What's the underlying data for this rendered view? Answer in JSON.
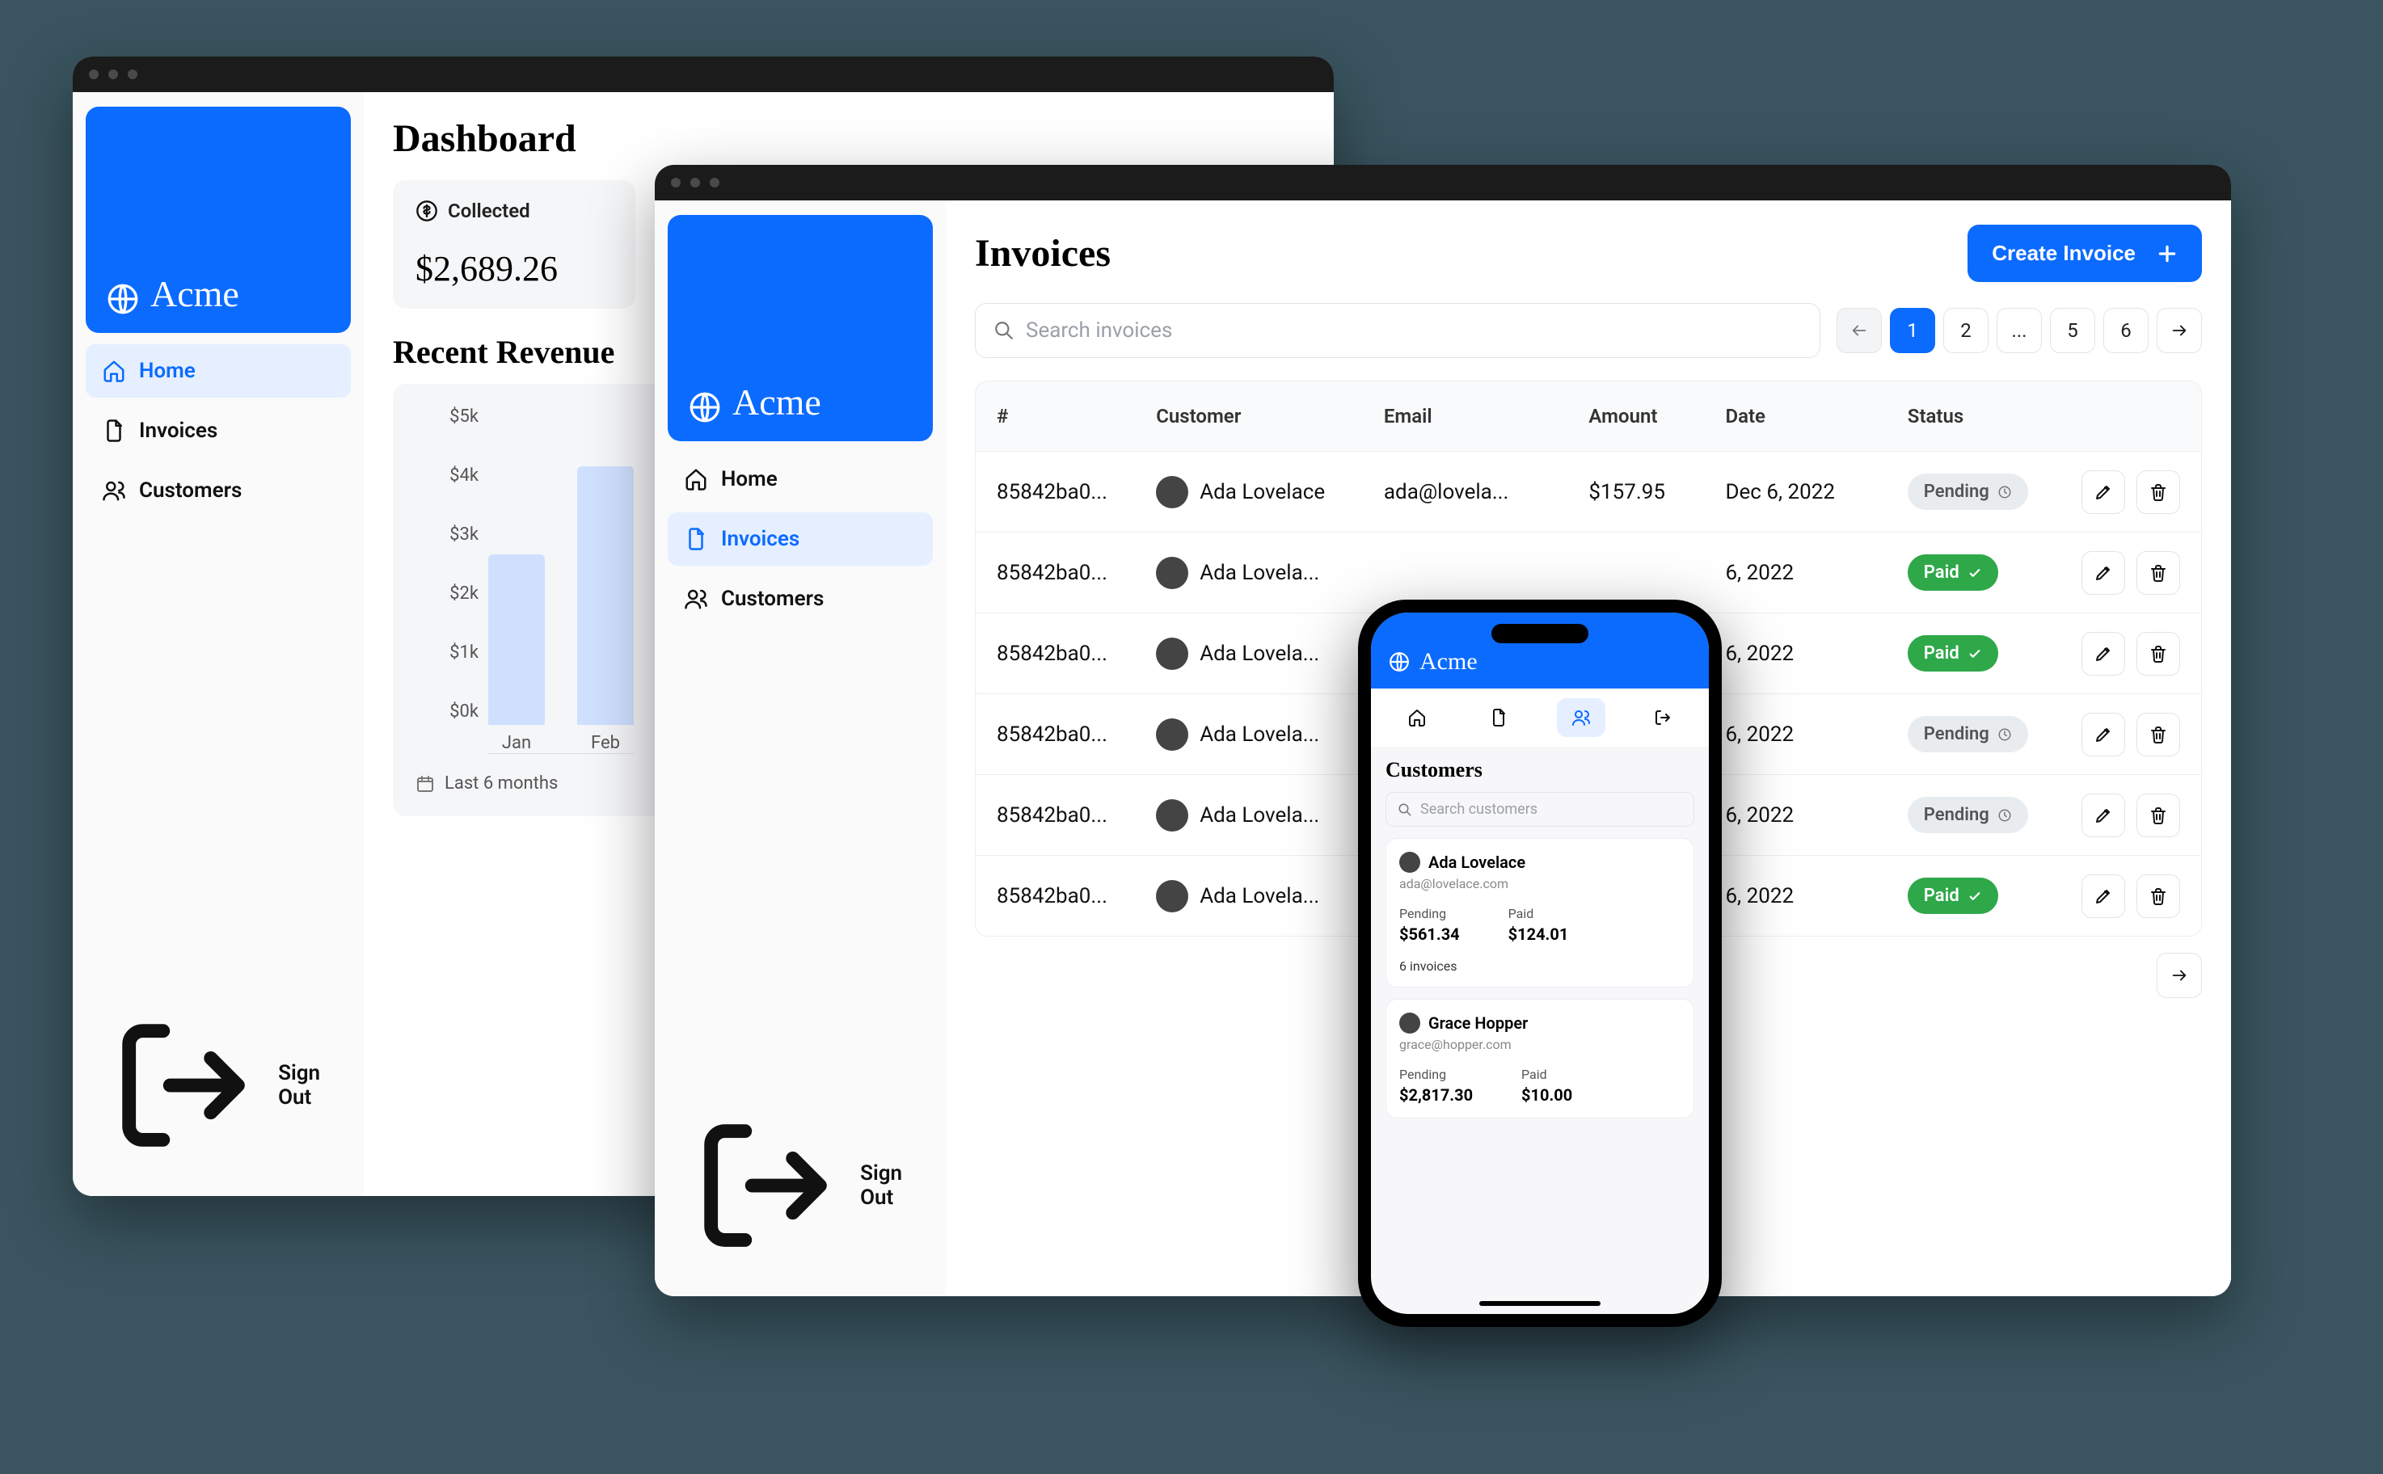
{
  "brand": {
    "name": "Acme"
  },
  "sidebar": {
    "items": [
      {
        "label": "Home"
      },
      {
        "label": "Invoices"
      },
      {
        "label": "Customers"
      }
    ],
    "signout_label": "Sign Out"
  },
  "dashboard": {
    "title": "Dashboard",
    "cards": {
      "collected": {
        "label": "Collected",
        "value": "$2,689.26"
      }
    },
    "revenue": {
      "title": "Recent Revenue",
      "footer": "Last 6 months"
    }
  },
  "chart_data": {
    "type": "bar",
    "title": "Recent Revenue",
    "xlabel": "",
    "ylabel": "",
    "ylim": [
      0,
      5000
    ],
    "yticks": [
      "$5k",
      "$4k",
      "$3k",
      "$2k",
      "$1k",
      "$0k"
    ],
    "categories": [
      "Jan",
      "Feb"
    ],
    "values": [
      2700,
      4100
    ]
  },
  "invoices": {
    "title": "Invoices",
    "create_label": "Create Invoice",
    "search_placeholder": "Search invoices",
    "pager": {
      "pages": [
        "1",
        "2",
        "...",
        "5",
        "6"
      ],
      "current": "1"
    },
    "columns": [
      "#",
      "Customer",
      "Email",
      "Amount",
      "Date",
      "Status"
    ],
    "rows": [
      {
        "id": "85842ba0...",
        "customer": "Ada Lovelace",
        "email": "ada@lovela...",
        "amount": "$157.95",
        "date": "Dec 6, 2022",
        "status": "Pending"
      },
      {
        "id": "85842ba0...",
        "customer": "Ada Lovela...",
        "email": "",
        "amount": "",
        "date": "6, 2022",
        "status": "Paid"
      },
      {
        "id": "85842ba0...",
        "customer": "Ada Lovela...",
        "email": "",
        "amount": "",
        "date": "6, 2022",
        "status": "Paid"
      },
      {
        "id": "85842ba0...",
        "customer": "Ada Lovela...",
        "email": "",
        "amount": "",
        "date": "6, 2022",
        "status": "Pending"
      },
      {
        "id": "85842ba0...",
        "customer": "Ada Lovela...",
        "email": "",
        "amount": "",
        "date": "6, 2022",
        "status": "Pending"
      },
      {
        "id": "85842ba0...",
        "customer": "Ada Lovela...",
        "email": "",
        "amount": "",
        "date": "6, 2022",
        "status": "Paid"
      }
    ]
  },
  "mobile": {
    "title": "Customers",
    "search_placeholder": "Search customers",
    "customers": [
      {
        "name": "Ada Lovelace",
        "email": "ada@lovelace.com",
        "pending_label": "Pending",
        "pending_value": "$561.34",
        "paid_label": "Paid",
        "paid_value": "$124.01",
        "invoices_label": "6 invoices"
      },
      {
        "name": "Grace Hopper",
        "email": "grace@hopper.com",
        "pending_label": "Pending",
        "pending_value": "$2,817.30",
        "paid_label": "Paid",
        "paid_value": "$10.00",
        "invoices_label": ""
      }
    ]
  },
  "status_labels": {
    "pending": "Pending",
    "paid": "Paid"
  }
}
